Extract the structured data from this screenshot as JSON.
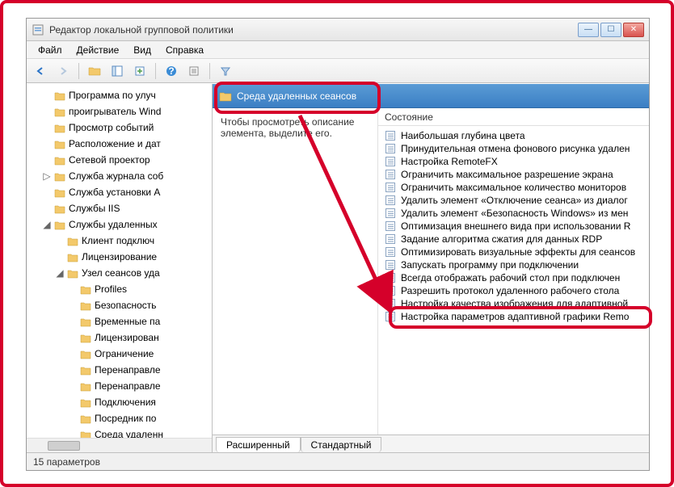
{
  "window": {
    "title": "Редактор локальной групповой политики"
  },
  "menu": {
    "file": "Файл",
    "action": "Действие",
    "view": "Вид",
    "help": "Справка"
  },
  "tree": {
    "items": [
      "Программа по улуч",
      "проигрыватель Wind",
      "Просмотр событий",
      "Расположение и дат",
      "Сетевой проектор",
      "Служба журнала соб",
      "Служба установки A",
      "Службы IIS"
    ],
    "expanded_label": "Службы удаленных",
    "children1": [
      "Клиент подключ",
      "Лицензирование"
    ],
    "expanded2_label": "Узел сеансов уда",
    "children2": [
      "Profiles",
      "Безопасность",
      "Временные па",
      "Лицензирован",
      "Ограничение",
      "Перенаправле",
      "Перенаправле",
      "Подключения",
      "Посредник по",
      "Среда удаленн"
    ]
  },
  "detail": {
    "header": "Среда удаленных сеансов",
    "description": "Чтобы просмотреть описание элемента, выделите его.",
    "column_header": "Состояние",
    "items": [
      "Наибольшая глубина цвета",
      "Принудительная отмена фонового рисунка удален",
      "Настройка RemoteFX",
      "Ограничить максимальное разрешение экрана",
      "Ограничить максимальное количество мониторов",
      "Удалить элемент «Отключение сеанса» из диалог",
      "Удалить элемент «Безопасность Windows» из мен",
      "Оптимизация внешнего вида при использовании R",
      "Задание алгоритма сжатия для данных RDP",
      "Оптимизировать визуальные эффекты для сеансов",
      "Запускать программу при подключении",
      "Всегда отображать рабочий стол при подключен",
      "Разрешить протокол удаленного рабочего стола",
      "Настройка качества изображения для адаптивной",
      "Настройка параметров адаптивной графики Remo"
    ]
  },
  "tabs": {
    "extended": "Расширенный",
    "standard": "Стандартный"
  },
  "status": "15 параметров"
}
